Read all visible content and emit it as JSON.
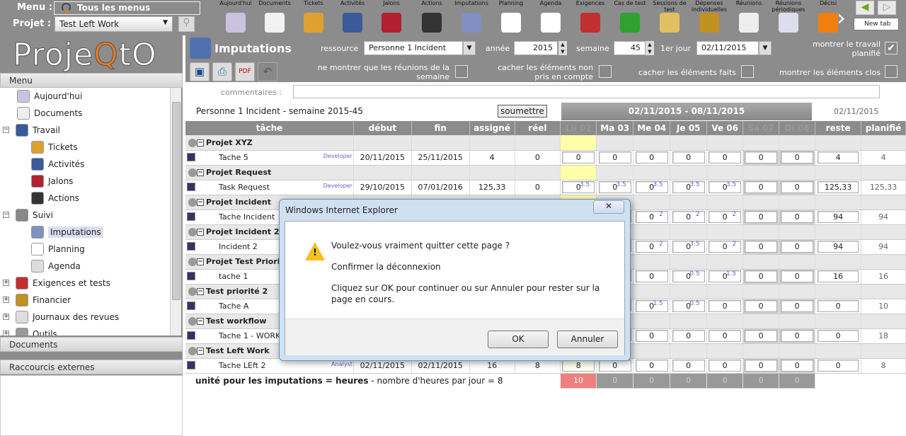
{
  "topbar": {
    "menu_label": "Menu :",
    "menu_value": "Tous les menus",
    "project_label": "Projet :",
    "project_value": "Test Left Work",
    "toolbar": [
      {
        "label": "Aujourd'hui",
        "color": "#c9c3e0"
      },
      {
        "label": "Documents",
        "color": "#f2f2f2"
      },
      {
        "label": "Tickets",
        "color": "#e0a030"
      },
      {
        "label": "Activités",
        "color": "#3a5a9a"
      },
      {
        "label": "Jalons",
        "color": "#b02030"
      },
      {
        "label": "Actions",
        "color": "#333333"
      },
      {
        "label": "Imputations",
        "color": "#8090c0"
      },
      {
        "label": "Planning",
        "color": "#ffffff"
      },
      {
        "label": "Agenda",
        "color": "#ffffff"
      },
      {
        "label": "Exigences",
        "color": "#c03030"
      },
      {
        "label": "Cas de test",
        "color": "#30a030"
      },
      {
        "label": "Sessions de test",
        "color": "#e0c060"
      },
      {
        "label": "Dépenses individuelles",
        "color": "#c09020"
      },
      {
        "label": "Réunions",
        "color": "#eeeeee"
      },
      {
        "label": "Réunions périodiques",
        "color": "#ddddee"
      },
      {
        "label": "Décisi",
        "color": "#f08010"
      }
    ],
    "new_tab": "New tab"
  },
  "sidebar": {
    "logo": "ProjeQtOr",
    "menu_header": "Menu",
    "items": [
      {
        "label": "Aujourd'hui"
      },
      {
        "label": "Documents"
      },
      {
        "label": "Travail"
      },
      {
        "label": "Tickets"
      },
      {
        "label": "Activités"
      },
      {
        "label": "Jalons"
      },
      {
        "label": "Actions"
      },
      {
        "label": "Suivi"
      },
      {
        "label": "Imputations"
      },
      {
        "label": "Planning"
      },
      {
        "label": "Agenda"
      },
      {
        "label": "Exigences et tests"
      },
      {
        "label": "Financier"
      },
      {
        "label": "Journaux des revues"
      },
      {
        "label": "Outils"
      }
    ],
    "documents_header": "Documents",
    "shortcuts_header": "Raccourcis externes"
  },
  "header": {
    "title": "Imputations",
    "resource_label": "ressource",
    "resource_value": "Personne 1 Incident",
    "year_label": "année",
    "year_value": "2015",
    "week_label": "semaine",
    "week_value": "45",
    "first_day_label": "1er jour",
    "first_day_value": "02/11/2015",
    "show_planned_label": "montrer le travail planifié",
    "opt_meetings": "ne montrer que les réunions de la semaine",
    "opt_hide_not_counted": "cacher les éléments non pris en compte",
    "opt_hide_done": "cacher les éléments faits",
    "opt_show_closed": "montrer les éléments clos",
    "comments_label": "commentaires :"
  },
  "grid": {
    "caption": "Personne 1 Incident - semaine 2015-45",
    "submit": "soumettre",
    "week_range": "02/11/2015 - 08/11/2015",
    "date_right": "02/11/2015",
    "columns": [
      "tâche",
      "début",
      "fin",
      "assigné",
      "réel",
      "Lu 02",
      "Ma 03",
      "Me 04",
      "Je 05",
      "Ve 06",
      "Sa 07",
      "Di 08",
      "reste",
      "planifié"
    ],
    "groups": [
      {
        "project": "Projet XYZ",
        "task": "Tache 5",
        "role": "Developer",
        "start": "20/11/2015",
        "end": "25/11/2015",
        "assigned": "4",
        "real": "0",
        "days": [
          "0",
          "0",
          "0",
          "0",
          "0",
          "0",
          "0"
        ],
        "planned_days": [
          "",
          "",
          "",
          "",
          "",
          "",
          ""
        ],
        "left": "4",
        "planned": "4"
      },
      {
        "project": "Projet Request",
        "task": "Task Request",
        "role": "Developer",
        "start": "29/10/2015",
        "end": "07/01/2016",
        "assigned": "125,33",
        "real": "0",
        "days": [
          "0",
          "0",
          "0",
          "0",
          "0",
          "0",
          "0"
        ],
        "planned_days": [
          "3.5",
          "3.5",
          "3.5",
          "3.5",
          "3.5",
          "",
          ""
        ],
        "left": "125,33",
        "planned": "125,33"
      },
      {
        "project": "Projet Incident",
        "task": "Tache Incident",
        "role": "",
        "start": "",
        "end": "",
        "assigned": "",
        "real": "",
        "days": [
          "",
          "",
          "0",
          "0",
          "0",
          "0",
          "0"
        ],
        "planned_days": [
          "",
          "",
          "2",
          "2",
          "2",
          "",
          ""
        ],
        "left": "94",
        "planned": "94"
      },
      {
        "project": "Projet Incident 2",
        "task": "Incident 2",
        "role": "",
        "start": "",
        "end": "",
        "assigned": "",
        "real": "",
        "days": [
          "",
          "",
          "0",
          "0",
          "0",
          "0",
          "0"
        ],
        "planned_days": [
          "",
          "",
          "2",
          "3.5",
          "2",
          "",
          ""
        ],
        "left": "94",
        "planned": "94"
      },
      {
        "project": "Projet Test Priorité",
        "task": "tache 1",
        "role": "",
        "start": "",
        "end": "",
        "assigned": "",
        "real": "",
        "days": [
          "",
          "",
          "0",
          "0",
          "0",
          "0",
          "0"
        ],
        "planned_days": [
          "",
          "",
          "",
          "0.5",
          "1.5",
          "",
          ""
        ],
        "left": "16",
        "planned": "16"
      },
      {
        "project": "Test priorité 2",
        "task": "Tache A",
        "role": "",
        "start": "",
        "end": "",
        "assigned": "",
        "real": "",
        "days": [
          "",
          "",
          "0",
          "0",
          "0",
          "0",
          "0"
        ],
        "planned_days": [
          "",
          "",
          "1.5",
          "0.5",
          "",
          "",
          ""
        ],
        "left": "0",
        "planned": "10"
      },
      {
        "project": "Test workflow",
        "task": "Tache 1 - WORKFLOW",
        "role": "",
        "start": "",
        "end": "",
        "assigned": "",
        "real": "",
        "days": [
          "",
          "",
          "0",
          "0",
          "0",
          "0",
          "0"
        ],
        "planned_days": [
          "",
          "",
          "",
          "",
          "",
          "",
          ""
        ],
        "left": "0",
        "planned": "18"
      },
      {
        "project": "Test Left Work",
        "task": "Tache LEft 2",
        "role": "Analyst",
        "start": "02/11/2015",
        "end": "02/11/2015",
        "assigned": "16",
        "real": "8",
        "days": [
          "8",
          "0",
          "0",
          "0",
          "0",
          "0",
          "0"
        ],
        "planned_days": [
          "",
          "",
          "",
          "",
          "",
          "",
          ""
        ],
        "left": "0",
        "planned": "8"
      }
    ],
    "footer_unit": "unité pour les imputations = heures",
    "footer_hours": " - nombre d'heures par jour = 8",
    "totals": [
      "10",
      "0",
      "0",
      "0",
      "0",
      "0",
      "0"
    ]
  },
  "dialog": {
    "title": "Windows Internet Explorer",
    "line1": "Voulez-vous vraiment quitter cette page ?",
    "line2": "Confirmer la déconnexion",
    "line3": "Cliquez sur OK pour continuer ou sur Annuler pour rester sur la page en cours.",
    "ok": "OK",
    "cancel": "Annuler"
  }
}
